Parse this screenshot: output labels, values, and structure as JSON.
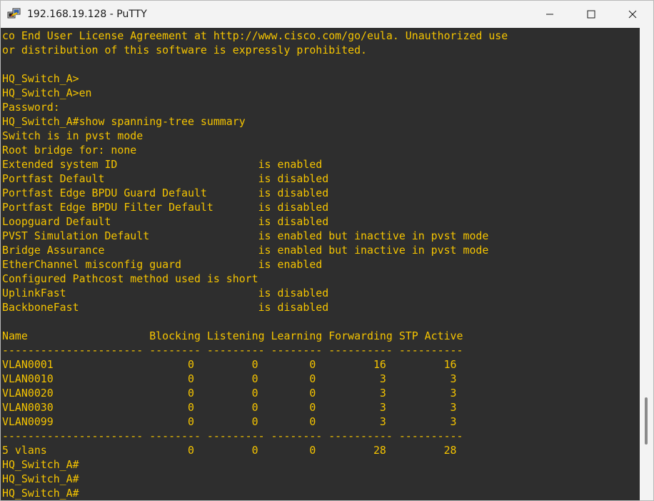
{
  "window": {
    "title": "192.168.19.128 - PuTTY",
    "app_icon": "putty-icon",
    "buttons": {
      "minimize": "minimize-icon",
      "maximize": "maximize-icon",
      "close": "close-icon"
    }
  },
  "colors": {
    "terminal_bg": "#2e2e2e",
    "terminal_fg": "#f5c400",
    "titlebar_bg": "#f3f3f3"
  },
  "terminal": {
    "lines": [
      "co End User License Agreement at http://www.cisco.com/go/eula. Unauthorized use",
      "or distribution of this software is expressly prohibited.",
      "",
      "HQ_Switch_A>",
      "HQ_Switch_A>en",
      "Password:",
      "HQ_Switch_A#show spanning-tree summary",
      "Switch is in pvst mode",
      "Root bridge for: none",
      "Extended system ID                      is enabled",
      "Portfast Default                        is disabled",
      "Portfast Edge BPDU Guard Default        is disabled",
      "Portfast Edge BPDU Filter Default       is disabled",
      "Loopguard Default                       is disabled",
      "PVST Simulation Default                 is enabled but inactive in pvst mode",
      "Bridge Assurance                        is enabled but inactive in pvst mode",
      "EtherChannel misconfig guard            is enabled",
      "Configured Pathcost method used is short",
      "UplinkFast                              is disabled",
      "BackboneFast                            is disabled",
      "",
      "Name                   Blocking Listening Learning Forwarding STP Active",
      "---------------------- -------- --------- -------- ---------- ----------",
      "VLAN0001                     0         0        0         16         16",
      "VLAN0010                     0         0        0          3          3",
      "VLAN0020                     0         0        0          3          3",
      "VLAN0030                     0         0        0          3          3",
      "VLAN0099                     0         0        0          3          3",
      "---------------------- -------- --------- -------- ---------- ----------",
      "5 vlans                      0         0        0         28         28",
      "HQ_Switch_A#",
      "HQ_Switch_A#",
      "HQ_Switch_A#"
    ]
  }
}
